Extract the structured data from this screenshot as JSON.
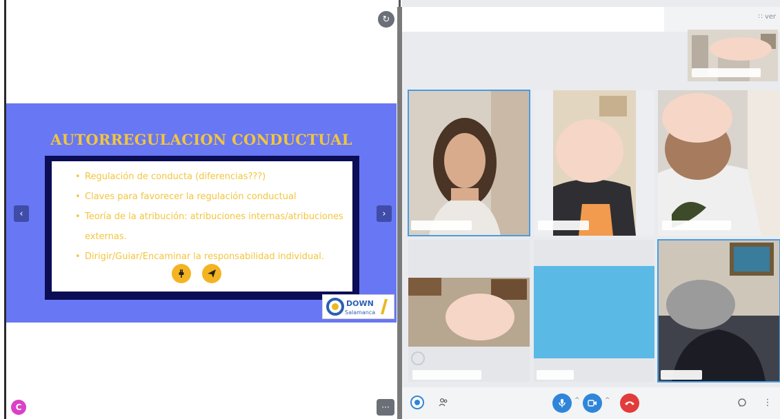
{
  "slide": {
    "title": "AUTORREGULACION CONDUCTUAL",
    "bullets": [
      "Regulación de conducta (diferencias???)",
      "Claves para favorecer la regulación conductual",
      "Teoría de la atribución: atribuciones internas/atribuciones externas.",
      "Dirigir/Guiar/Encaminar la responsabilidad individual."
    ],
    "logo_top": "DOWN",
    "logo_bottom": "Salamanca",
    "prev_symbol": "‹",
    "next_symbol": "›"
  },
  "left_toolbar": {
    "top_icon": "refresh-icon",
    "brand_icon": "app-logo-icon",
    "more_label": "···"
  },
  "video": {
    "view_label": "ver",
    "view_icon": "grid-icon"
  },
  "controls": {
    "mic_icon": "microphone-icon",
    "camera_icon": "camera-icon",
    "hangup_icon": "hangup-icon",
    "people_icon": "people-icon",
    "chat_icon": "chat-icon",
    "more_icon": "more-vertical-icon"
  },
  "colors": {
    "slide_bg": "#6877f3",
    "slide_text": "#f2c53d",
    "slide_frame": "#0b0d55",
    "accent_blue": "#2f86d9",
    "hangup_red": "#e23b3b",
    "active_outline": "#4a9be0"
  }
}
